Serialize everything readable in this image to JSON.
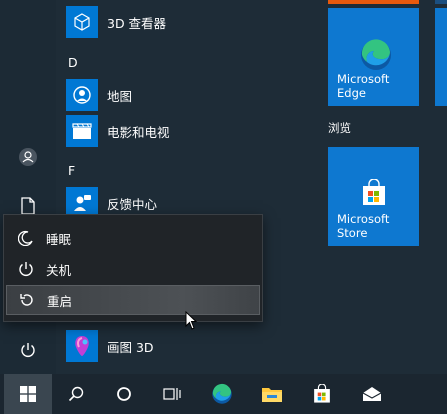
{
  "apps": {
    "viewer3d": "3D 查看器",
    "letter_d": "D",
    "maps": "地图",
    "movies": "电影和电视",
    "letter_f": "F",
    "feedback": "反馈中心",
    "paint3d": "画图 3D"
  },
  "tiles": {
    "edge_label": "Microsoft Edge",
    "group_browse": "浏览",
    "store_label": "Microsoft Store"
  },
  "power_menu": {
    "sleep": "睡眠",
    "shutdown": "关机",
    "restart": "重启"
  },
  "colors": {
    "accent": "#0078d4",
    "start_bg": "#1e2c37",
    "taskbar_bg": "#1b2630"
  }
}
